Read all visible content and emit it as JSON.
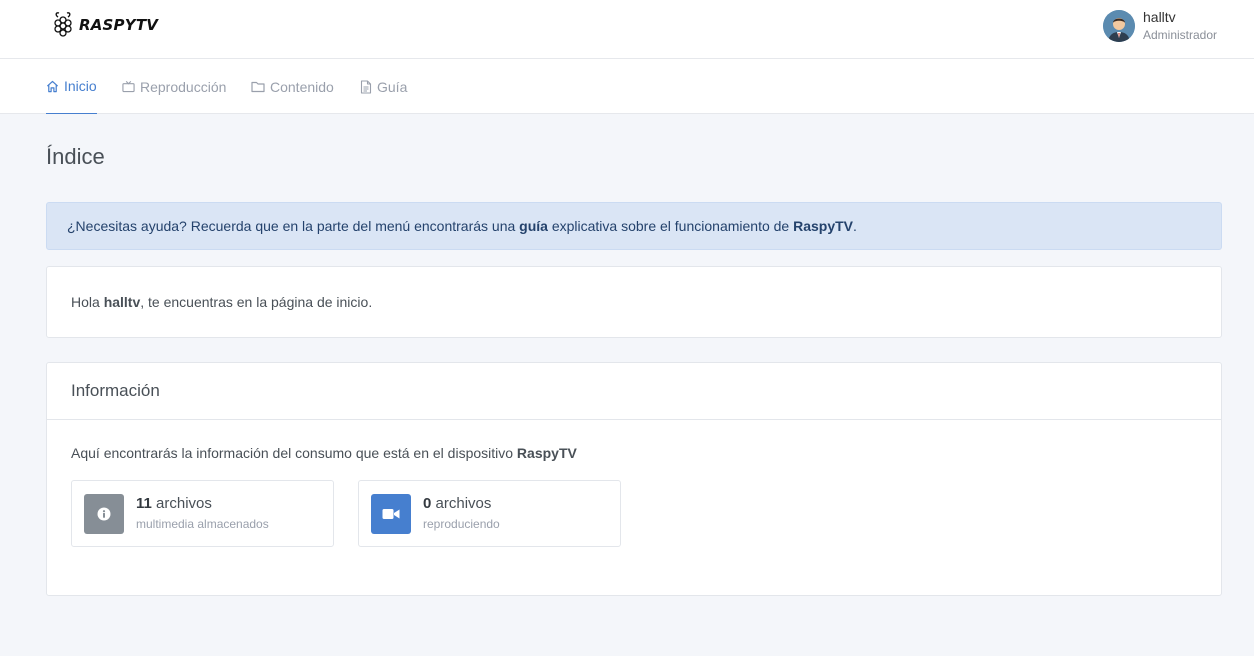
{
  "brand": {
    "name": "RASPYTV"
  },
  "user": {
    "name": "halltv",
    "role": "Administrador"
  },
  "nav": {
    "items": [
      {
        "label": "Inicio",
        "icon": "home-icon",
        "active": true
      },
      {
        "label": "Reproducción",
        "icon": "tv-icon"
      },
      {
        "label": "Contenido",
        "icon": "folder-icon"
      },
      {
        "label": "Guía",
        "icon": "file-text-icon"
      }
    ]
  },
  "page": {
    "title": "Índice"
  },
  "alert": {
    "prefix": "¿Necesitas ayuda? Recuerda que en la parte del menú encontrarás una ",
    "bold1": "guía",
    "middle": " explicativa sobre el funcionamiento de ",
    "bold2": "RaspyTV",
    "suffix": "."
  },
  "greeting": {
    "prefix": "Hola ",
    "user": "halltv",
    "suffix": ", te encuentras en la página de inicio."
  },
  "info": {
    "title": "Información",
    "description_prefix": "Aquí encontrarás la información del consumo que está en el dispositivo ",
    "description_bold": "RaspyTV",
    "stats": [
      {
        "count": "11",
        "unit": "archivos",
        "label": "multimedia almacenados",
        "icon": "info-icon",
        "color": "#868e96"
      },
      {
        "count": "0",
        "unit": "archivos",
        "label": "reproduciendo",
        "icon": "video-camera-icon",
        "color": "#467fcf"
      }
    ]
  },
  "colors": {
    "accent": "#467fcf",
    "alert_bg": "#dae5f5",
    "page_bg": "#f4f6fa"
  }
}
